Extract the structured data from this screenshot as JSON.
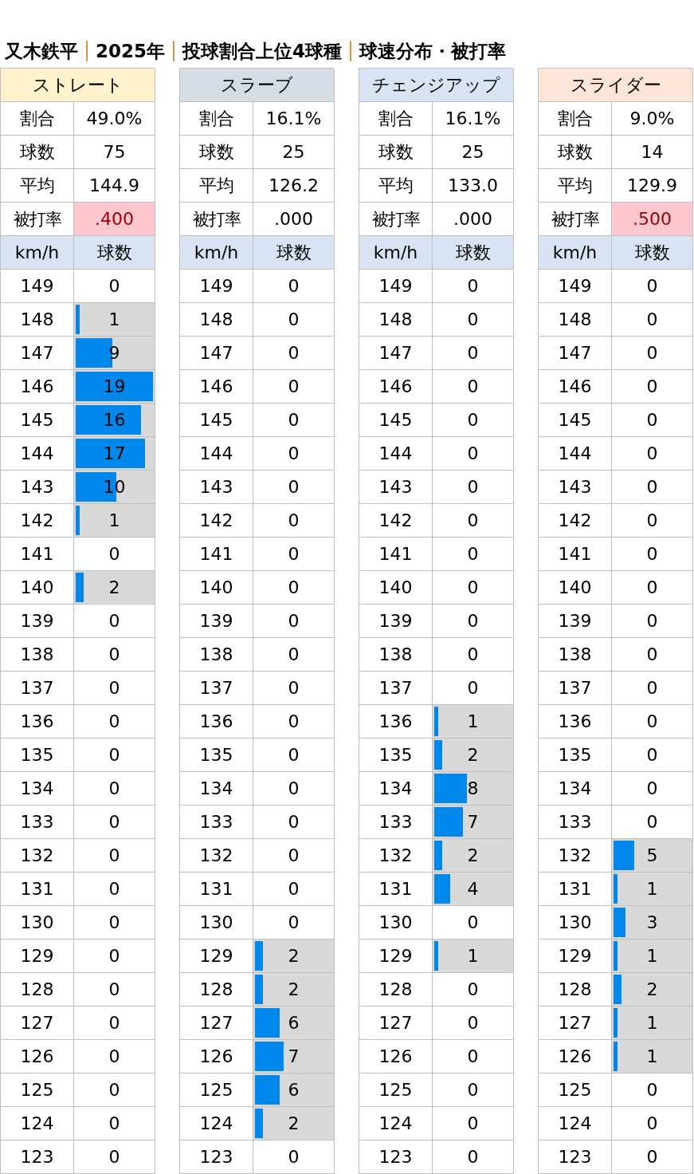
{
  "title": [
    "又木鉄平",
    "2025年",
    "投球割合上位4球種",
    "球速分布・被打率"
  ],
  "pitches": [
    {
      "name": "ストレート",
      "color": "#fff2cc",
      "stats": [
        {
          "label": "割合",
          "value": "49.0%",
          "highlight": false
        },
        {
          "label": "球数",
          "value": "75",
          "highlight": false
        },
        {
          "label": "平均",
          "value": "144.9",
          "highlight": false
        },
        {
          "label": "被打率",
          "value": ".400",
          "highlight": true
        }
      ],
      "columns": [
        "km/h",
        "球数"
      ],
      "rows": [
        {
          "kmh": "149",
          "count": "0"
        },
        {
          "kmh": "148",
          "count": "1",
          "level": 0.053
        },
        {
          "kmh": "147",
          "count": "9",
          "level": 0.474
        },
        {
          "kmh": "146",
          "count": "19",
          "level": 1
        },
        {
          "kmh": "145",
          "count": "16",
          "level": 0.842
        },
        {
          "kmh": "144",
          "count": "17",
          "level": 0.895
        },
        {
          "kmh": "143",
          "count": "10",
          "level": 0.526
        },
        {
          "kmh": "142",
          "count": "1",
          "level": 0.053
        },
        {
          "kmh": "141",
          "count": "0"
        },
        {
          "kmh": "140",
          "count": "2",
          "level": 0.105
        },
        {
          "kmh": "139",
          "count": "0"
        },
        {
          "kmh": "138",
          "count": "0"
        },
        {
          "kmh": "137",
          "count": "0"
        },
        {
          "kmh": "136",
          "count": "0"
        },
        {
          "kmh": "135",
          "count": "0"
        },
        {
          "kmh": "134",
          "count": "0"
        },
        {
          "kmh": "133",
          "count": "0"
        },
        {
          "kmh": "132",
          "count": "0"
        },
        {
          "kmh": "131",
          "count": "0"
        },
        {
          "kmh": "130",
          "count": "0"
        },
        {
          "kmh": "129",
          "count": "0"
        },
        {
          "kmh": "128",
          "count": "0"
        },
        {
          "kmh": "127",
          "count": "0"
        },
        {
          "kmh": "126",
          "count": "0"
        },
        {
          "kmh": "125",
          "count": "0"
        },
        {
          "kmh": "124",
          "count": "0"
        },
        {
          "kmh": "123",
          "count": "0"
        }
      ]
    },
    {
      "name": "スラーブ",
      "color": "#d6dce4",
      "stats": [
        {
          "label": "割合",
          "value": "16.1%",
          "highlight": false
        },
        {
          "label": "球数",
          "value": "25",
          "highlight": false
        },
        {
          "label": "平均",
          "value": "126.2",
          "highlight": false
        },
        {
          "label": "被打率",
          "value": ".000",
          "highlight": false
        }
      ],
      "columns": [
        "km/h",
        "球数"
      ],
      "rows": [
        {
          "kmh": "149",
          "count": "0"
        },
        {
          "kmh": "148",
          "count": "0"
        },
        {
          "kmh": "147",
          "count": "0"
        },
        {
          "kmh": "146",
          "count": "0"
        },
        {
          "kmh": "145",
          "count": "0"
        },
        {
          "kmh": "144",
          "count": "0"
        },
        {
          "kmh": "143",
          "count": "0"
        },
        {
          "kmh": "142",
          "count": "0"
        },
        {
          "kmh": "141",
          "count": "0"
        },
        {
          "kmh": "140",
          "count": "0"
        },
        {
          "kmh": "139",
          "count": "0"
        },
        {
          "kmh": "138",
          "count": "0"
        },
        {
          "kmh": "137",
          "count": "0"
        },
        {
          "kmh": "136",
          "count": "0"
        },
        {
          "kmh": "135",
          "count": "0"
        },
        {
          "kmh": "134",
          "count": "0"
        },
        {
          "kmh": "133",
          "count": "0"
        },
        {
          "kmh": "132",
          "count": "0"
        },
        {
          "kmh": "131",
          "count": "0"
        },
        {
          "kmh": "130",
          "count": "0"
        },
        {
          "kmh": "129",
          "count": "2",
          "level": 0.105
        },
        {
          "kmh": "128",
          "count": "2",
          "level": 0.105
        },
        {
          "kmh": "127",
          "count": "6",
          "level": 0.316
        },
        {
          "kmh": "126",
          "count": "7",
          "level": 0.368
        },
        {
          "kmh": "125",
          "count": "6",
          "level": 0.316
        },
        {
          "kmh": "124",
          "count": "2",
          "level": 0.105
        },
        {
          "kmh": "123",
          "count": "0"
        }
      ]
    },
    {
      "name": "チェンジアップ",
      "color": "#dae3f3",
      "stats": [
        {
          "label": "割合",
          "value": "16.1%",
          "highlight": false
        },
        {
          "label": "球数",
          "value": "25",
          "highlight": false
        },
        {
          "label": "平均",
          "value": "133.0",
          "highlight": false
        },
        {
          "label": "被打率",
          "value": ".000",
          "highlight": false
        }
      ],
      "columns": [
        "km/h",
        "球数"
      ],
      "rows": [
        {
          "kmh": "149",
          "count": "0"
        },
        {
          "kmh": "148",
          "count": "0"
        },
        {
          "kmh": "147",
          "count": "0"
        },
        {
          "kmh": "146",
          "count": "0"
        },
        {
          "kmh": "145",
          "count": "0"
        },
        {
          "kmh": "144",
          "count": "0"
        },
        {
          "kmh": "143",
          "count": "0"
        },
        {
          "kmh": "142",
          "count": "0"
        },
        {
          "kmh": "141",
          "count": "0"
        },
        {
          "kmh": "140",
          "count": "0"
        },
        {
          "kmh": "139",
          "count": "0"
        },
        {
          "kmh": "138",
          "count": "0"
        },
        {
          "kmh": "137",
          "count": "0"
        },
        {
          "kmh": "136",
          "count": "1",
          "level": 0.053
        },
        {
          "kmh": "135",
          "count": "2",
          "level": 0.105
        },
        {
          "kmh": "134",
          "count": "8",
          "level": 0.421
        },
        {
          "kmh": "133",
          "count": "7",
          "level": 0.368
        },
        {
          "kmh": "132",
          "count": "2",
          "level": 0.105
        },
        {
          "kmh": "131",
          "count": "4",
          "level": 0.211
        },
        {
          "kmh": "130",
          "count": "0"
        },
        {
          "kmh": "129",
          "count": "1",
          "level": 0.053
        },
        {
          "kmh": "128",
          "count": "0"
        },
        {
          "kmh": "127",
          "count": "0"
        },
        {
          "kmh": "126",
          "count": "0"
        },
        {
          "kmh": "125",
          "count": "0"
        },
        {
          "kmh": "124",
          "count": "0"
        },
        {
          "kmh": "123",
          "count": "0"
        }
      ]
    },
    {
      "name": "スライダー",
      "color": "#fce4d6",
      "stats": [
        {
          "label": "割合",
          "value": "9.0%",
          "highlight": false
        },
        {
          "label": "球数",
          "value": "14",
          "highlight": false
        },
        {
          "label": "平均",
          "value": "129.9",
          "highlight": false
        },
        {
          "label": "被打率",
          "value": ".500",
          "highlight": true
        }
      ],
      "columns": [
        "km/h",
        "球数"
      ],
      "rows": [
        {
          "kmh": "149",
          "count": "0"
        },
        {
          "kmh": "148",
          "count": "0"
        },
        {
          "kmh": "147",
          "count": "0"
        },
        {
          "kmh": "146",
          "count": "0"
        },
        {
          "kmh": "145",
          "count": "0"
        },
        {
          "kmh": "144",
          "count": "0"
        },
        {
          "kmh": "143",
          "count": "0"
        },
        {
          "kmh": "142",
          "count": "0"
        },
        {
          "kmh": "141",
          "count": "0"
        },
        {
          "kmh": "140",
          "count": "0"
        },
        {
          "kmh": "139",
          "count": "0"
        },
        {
          "kmh": "138",
          "count": "0"
        },
        {
          "kmh": "137",
          "count": "0"
        },
        {
          "kmh": "136",
          "count": "0"
        },
        {
          "kmh": "135",
          "count": "0"
        },
        {
          "kmh": "134",
          "count": "0"
        },
        {
          "kmh": "133",
          "count": "0"
        },
        {
          "kmh": "132",
          "count": "5",
          "level": 0.263
        },
        {
          "kmh": "131",
          "count": "1",
          "level": 0.053
        },
        {
          "kmh": "130",
          "count": "3",
          "level": 0.158
        },
        {
          "kmh": "129",
          "count": "1",
          "level": 0.053
        },
        {
          "kmh": "128",
          "count": "2",
          "level": 0.105
        },
        {
          "kmh": "127",
          "count": "1",
          "level": 0.053
        },
        {
          "kmh": "126",
          "count": "1",
          "level": 0.053
        },
        {
          "kmh": "125",
          "count": "0"
        },
        {
          "kmh": "124",
          "count": "0"
        },
        {
          "kmh": "123",
          "count": "0"
        }
      ]
    }
  ]
}
